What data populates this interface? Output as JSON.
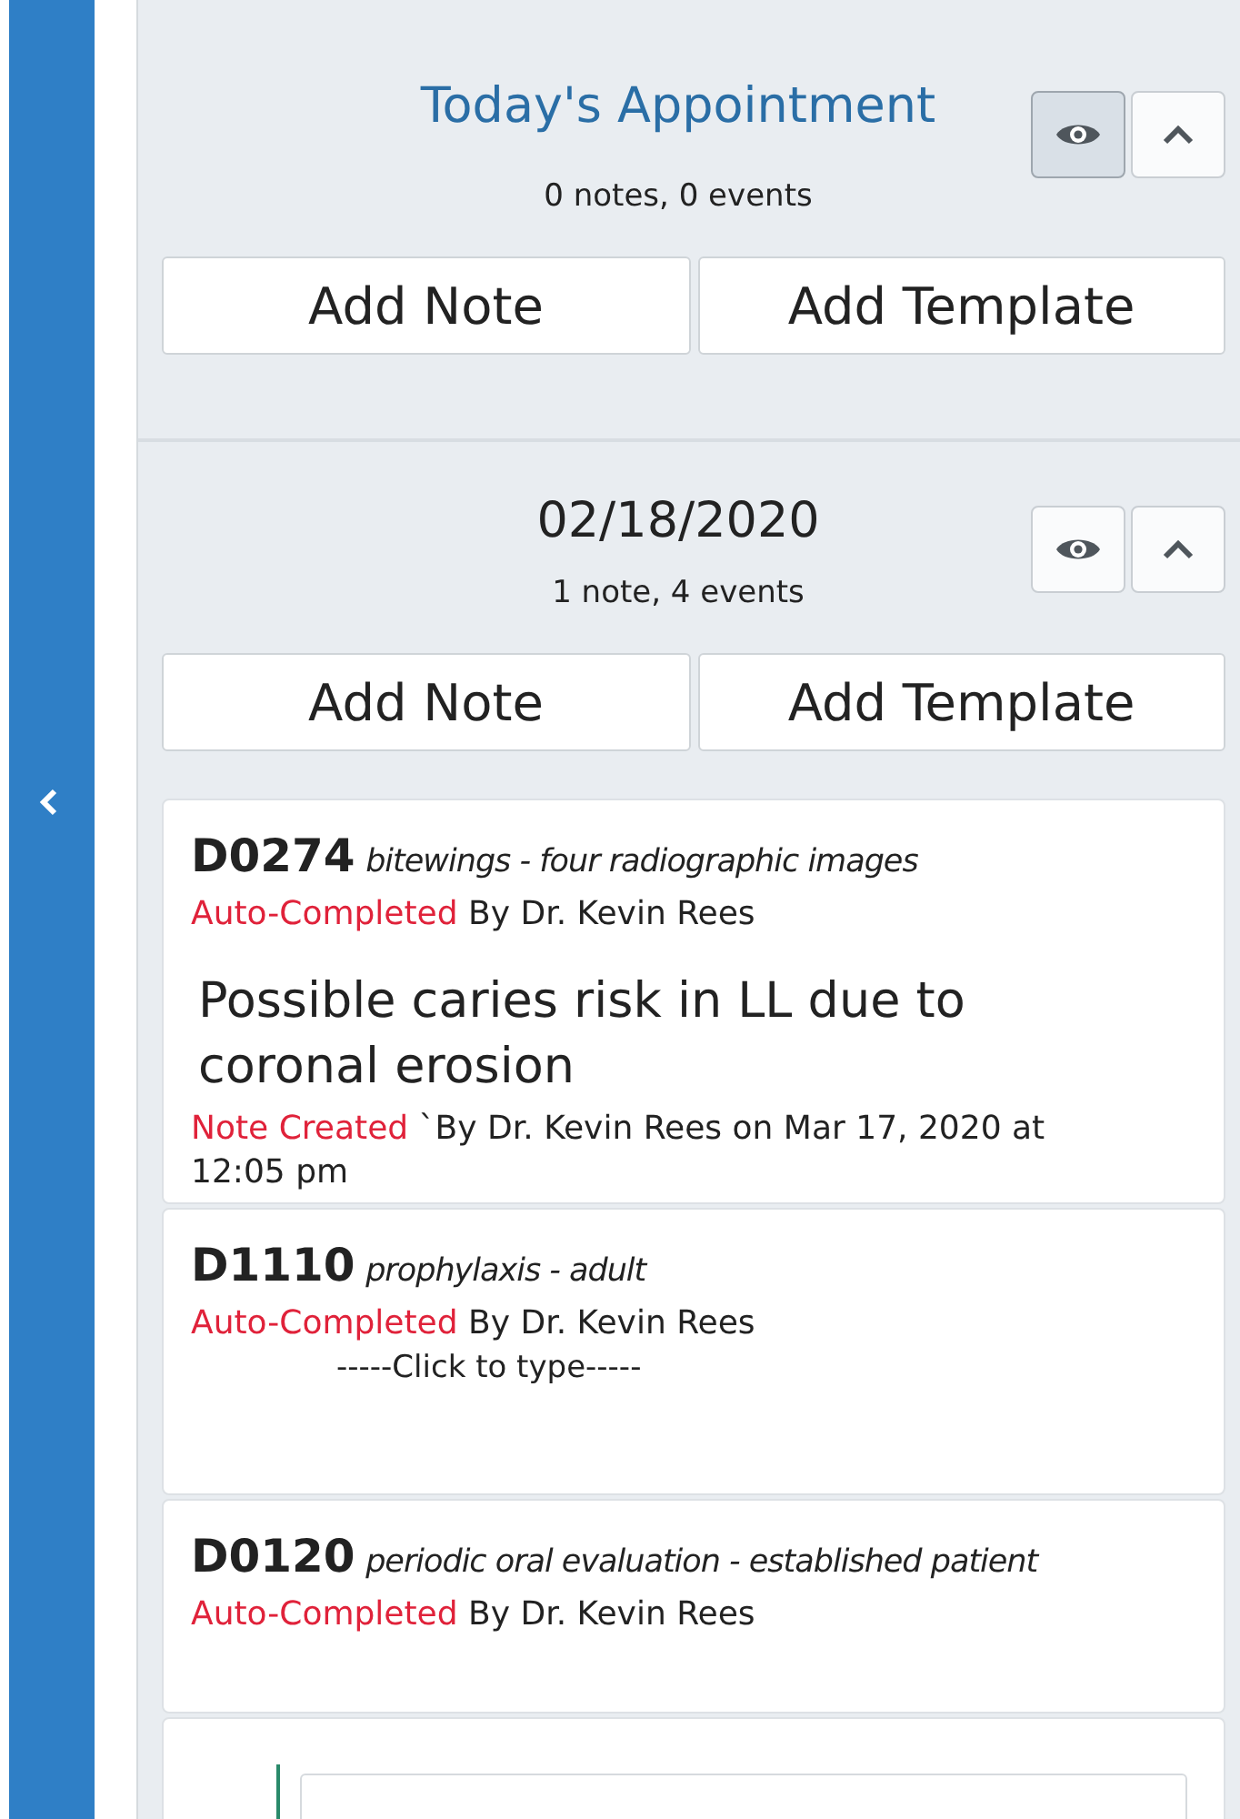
{
  "sidebar": {
    "collapsed": true
  },
  "sections": [
    {
      "title": "Today's Appointment",
      "highlighted": true,
      "summary": "0 notes,  0 events",
      "visible": true,
      "expanded": true,
      "buttons": [
        "Add Note",
        "Add Template"
      ]
    },
    {
      "title": "02/18/2020",
      "highlighted": false,
      "summary": "1 note,  4 events",
      "visible": false,
      "expanded": true,
      "buttons": [
        "Add Note",
        "Add Template"
      ],
      "events": [
        {
          "kind": "procedure",
          "code": "D0274",
          "description": "bitewings - four radiographic images",
          "status": "Auto-Completed",
          "author": "By Dr. Kevin Rees",
          "note": {
            "text": "Possible caries risk in LL due to coronal erosion",
            "status": "Note Created",
            "meta": " `By Dr. Kevin Rees on Mar 17, 2020 at 12:05 pm"
          }
        },
        {
          "kind": "procedure",
          "code": "D1110",
          "description": "prophylaxis - adult",
          "status": "Auto-Completed",
          "author": "By Dr. Kevin Rees",
          "placeholder": "-----Click to type-----"
        },
        {
          "kind": "procedure",
          "code": "D0120",
          "description": "periodic oral evaluation - established patient",
          "status": "Auto-Completed",
          "author": "By Dr. Kevin Rees"
        },
        {
          "kind": "cut-off"
        }
      ]
    }
  ]
}
